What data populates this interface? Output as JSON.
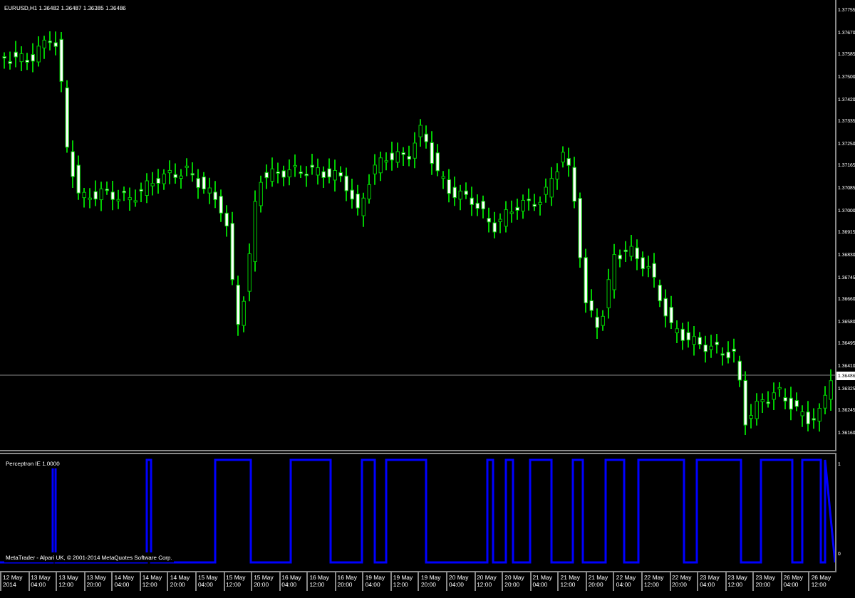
{
  "chart_title": "EURUSD,H1  1.36482 1.36487 1.36385 1.36486",
  "price_axis": [
    "1.37755",
    "1.37670",
    "1.37585",
    "1.37500",
    "1.37420",
    "1.37335",
    "1.37250",
    "1.37165",
    "1.37085",
    "1.37000",
    "1.36915",
    "1.36830",
    "1.36745",
    "1.36660",
    "1.36580",
    "1.36495",
    "1.36410",
    "1.36325",
    "1.36245",
    "1.36160"
  ],
  "current_price": "1.36486",
  "indicator": {
    "label": "Perceptron IE 1.0000",
    "axis": [
      "1",
      "0"
    ]
  },
  "copyright": "MetaTrader - Alpari UK, © 2001-2014 MetaQuotes Software Corp.",
  "time_axis": [
    "12 May 2014",
    "13 May 04:00",
    "13 May 12:00",
    "13 May 20:00",
    "14 May 04:00",
    "14 May 12:00",
    "14 May 20:00",
    "15 May 04:00",
    "15 May 12:00",
    "15 May 20:00",
    "16 May 04:00",
    "16 May 12:00",
    "16 May 20:00",
    "19 May 04:00",
    "19 May 12:00",
    "19 May 20:00",
    "20 May 04:00",
    "20 May 12:00",
    "20 May 20:00",
    "21 May 04:00",
    "21 May 12:00",
    "21 May 20:00",
    "22 May 04:00",
    "22 May 12:00",
    "22 May 20:00",
    "23 May 04:00",
    "23 May 12:00",
    "23 May 20:00",
    "26 May 04:00",
    "26 May 12:00"
  ]
}
